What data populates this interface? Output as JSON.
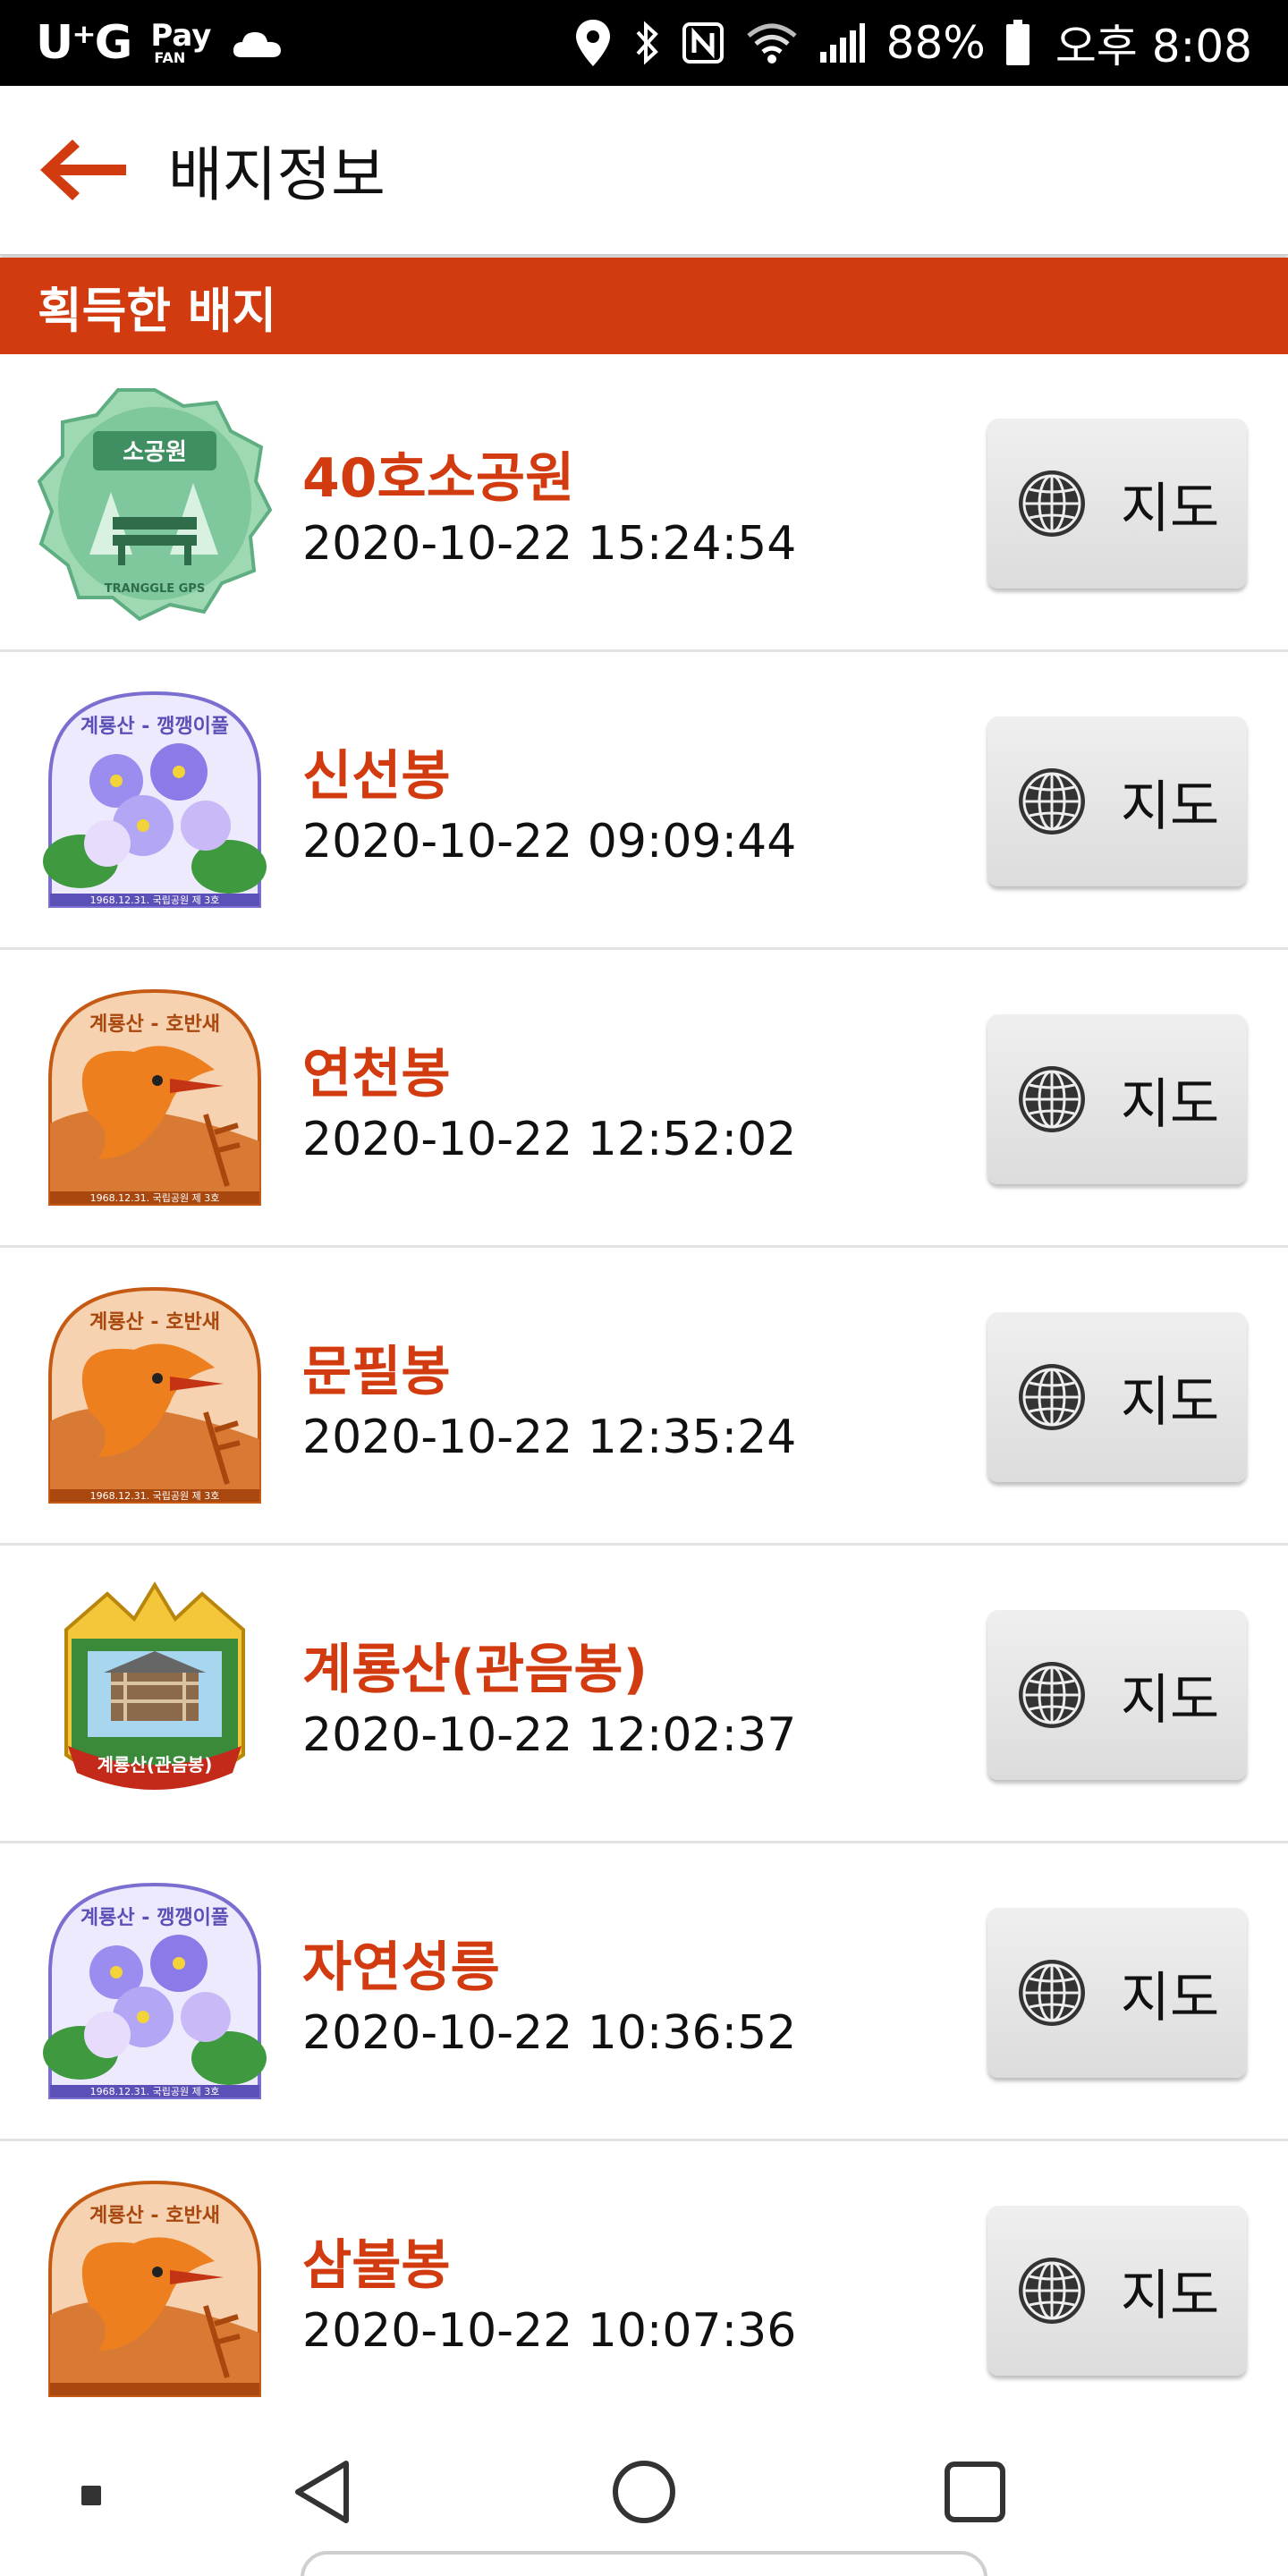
{
  "status_bar": {
    "carrier": "U⁺G",
    "pay_brand": "Pay",
    "pay_sub": "FAN",
    "battery": "88%",
    "time": "오후 8:08",
    "icons": [
      "cloud-icon",
      "location-icon",
      "bluetooth-icon",
      "nfc-icon",
      "wifi-icon",
      "signal-icon",
      "battery-icon"
    ]
  },
  "app_bar": {
    "title": "배지정보",
    "back_icon": "arrow-left-icon"
  },
  "section": {
    "title": "획득한 배지"
  },
  "badges": [
    {
      "name": "40호소공원",
      "date": "2020-10-22 15:24:54",
      "map_label": "지도",
      "badge_art": "park",
      "art_text": "소공원",
      "art_sub": "TRANGGLE GPS"
    },
    {
      "name": "신선봉",
      "date": "2020-10-22 09:09:44",
      "map_label": "지도",
      "badge_art": "flower",
      "art_text": "계룡산 - 깽깽이풀",
      "art_sub": "1968.12.31. 국립공원 제 3호"
    },
    {
      "name": "연천봉",
      "date": "2020-10-22 12:52:02",
      "map_label": "지도",
      "badge_art": "bird",
      "art_text": "계룡산 - 호반새",
      "art_sub": "1968.12.31. 국립공원 제 3호"
    },
    {
      "name": "문필봉",
      "date": "2020-10-22 12:35:24",
      "map_label": "지도",
      "badge_art": "bird",
      "art_text": "계룡산 - 호반새",
      "art_sub": "1968.12.31. 국립공원 제 3호"
    },
    {
      "name": "계룡산(관음봉)",
      "date": "2020-10-22 12:02:37",
      "map_label": "지도",
      "badge_art": "peak",
      "art_text": "계룡산(관음봉)",
      "art_sub": ""
    },
    {
      "name": "자연성릉",
      "date": "2020-10-22 10:36:52",
      "map_label": "지도",
      "badge_art": "flower",
      "art_text": "계룡산 - 깽깽이풀",
      "art_sub": "1968.12.31. 국립공원 제 3호"
    },
    {
      "name": "삼불봉",
      "date": "2020-10-22 10:07:36",
      "map_label": "지도",
      "badge_art": "bird",
      "art_text": "계룡산 - 호반새",
      "art_sub": ""
    }
  ],
  "nav_bar": {
    "buttons": [
      "dot-icon",
      "back-triangle-icon",
      "home-circle-icon",
      "recents-square-icon"
    ]
  },
  "colors": {
    "accent": "#d23a10",
    "status_bar_bg": "#000000",
    "button_bg": "#e6e6e6"
  }
}
